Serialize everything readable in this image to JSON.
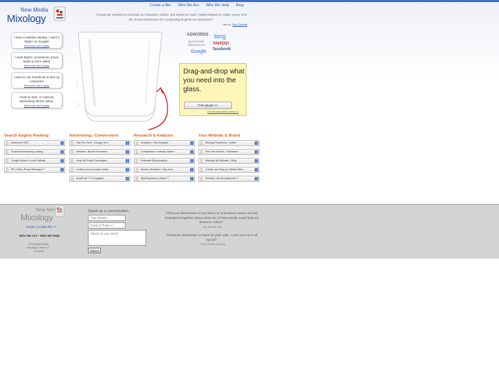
{
  "nav": [
    "Create a Mix",
    "Who We Are",
    "Who We Help",
    "Blog"
  ],
  "logo": {
    "line1": "New Media",
    "line2": "Mixology"
  },
  "top_quote": {
    "text": "\"I knew we needed to promote our business online, but where to start? NMM helped us make sense of it all. Great teammates for continuing to grow our business!\"",
    "author_prefix": "- Marco, ",
    "author_link": "Pan Clothing"
  },
  "options": [
    {
      "text": "I have a website already. I want it higher on Google!",
      "link": "Select then add to glass"
    },
    {
      "text": "I want higher conversions (more leads & more sales)",
      "link": "Select then add to glass"
    },
    {
      "text": "I want to use Facebook to find my customers",
      "link": "Select then add to glass"
    },
    {
      "text": "I want to start, or improve, advertising efforts online.",
      "link": "Select then add to glass"
    }
  ],
  "partners": {
    "adwords": "ADWORDS",
    "qualified": "QUALIFIED INDIVIDUAL",
    "google": "Google",
    "bing": "bing",
    "yahoo": "YAHOO!",
    "facebook": "facebook"
  },
  "dragbox": {
    "title": "Drag-and-drop what you need into the glass.",
    "button": "Free Quote >>",
    "link": "I'm not sure what I need >>"
  },
  "categories": [
    {
      "title": "Search Engine Ranking",
      "items": [
        "Advanced SEO",
        "Social Bookmarking Linking",
        "Google Maps & Local Listings",
        "PR / Micro Press Releases™"
      ]
    },
    {
      "title": "Advertising / Conversions",
      "items": [
        "Pay Per Click - Google (et..)",
        "Website / Brand Promotion",
        "Help My Email Campaigns",
        "Collect (more) Leads Online",
        "AutoPost™ to Craigslist"
      ]
    },
    {
      "title": "Research & Analysis",
      "items": [
        "Analytics / Site Analysis",
        "Competition / Industry Watch",
        "Relevant Blog Analysis",
        "Monitor Reviews / Yelp Acct",
        "MyeReputation Watch™"
      ]
    },
    {
      "title": "Your Website & Brand",
      "items": [
        "Manage Facebook / Twitter",
        "Find Me Friends / Followers!",
        "Manage My Website / Blog",
        "Create new Blog (or Mobile Site)",
        "Website / Brand Makeover™"
      ]
    }
  ],
  "footer": {
    "logo1": "New Media",
    "logo2": "Mixology",
    "create": "Create a Combo Mix >>",
    "who": "Who We Are - Who We Help",
    "copy": "©2010 New Media Mixology A Teen LLC Company",
    "spark": "Spark up a conversation.",
    "website_ph": "Your Website",
    "phone_ph": "Email or Phone #",
    "mind_ph": "What's on your mind?",
    "submit": "Submit",
    "test1": "\"They put themselves in my shoes as a business owner and we strategized together about what mix of New Media could help my business online.\"",
    "test1_by": "- Jill, Beauty Tula",
    "test2": "\"Fantastic teammates to have on your side.. I just can't do it all myself.\"",
    "test2_by": "- Cindy, Chelsi Garcing"
  },
  "colors": {
    "accent": "#e05a10",
    "link": "#2a55b0",
    "note": "#fdf6b8"
  }
}
